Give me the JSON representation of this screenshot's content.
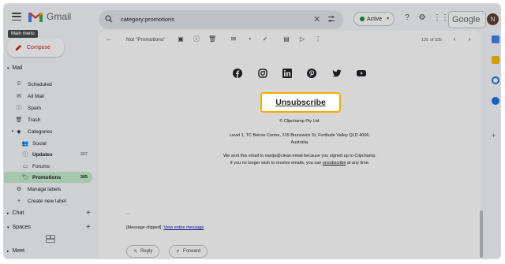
{
  "header": {
    "app_name": "Gmail",
    "search_value": "category:promotions",
    "status_label": "Active",
    "google_label": "Google",
    "avatar_initial": "N",
    "menu_tooltip": "Main menu"
  },
  "compose": {
    "label": "Compose"
  },
  "sidebar": {
    "mail_section": "Mail",
    "items": [
      {
        "icon": "scheduled-icon",
        "label": "Scheduled"
      },
      {
        "icon": "all-mail-icon",
        "label": "All Mail"
      },
      {
        "icon": "spam-icon",
        "label": "Spam"
      },
      {
        "icon": "trash-icon",
        "label": "Trash"
      },
      {
        "icon": "label-icon",
        "label": "Categories"
      },
      {
        "icon": "social-icon",
        "label": "Social"
      },
      {
        "icon": "updates-icon",
        "label": "Updates",
        "count": "387"
      },
      {
        "icon": "forums-icon",
        "label": "Forums"
      },
      {
        "icon": "promotions-icon",
        "label": "Promotions",
        "count": "305"
      },
      {
        "icon": "gear-icon",
        "label": "Manage labels"
      },
      {
        "icon": "plus-icon",
        "label": "Create new label"
      }
    ],
    "chat_section": "Chat",
    "spaces_section": "Spaces",
    "meet_section": "Meet"
  },
  "toolbar": {
    "label": "Not \"Promotions\"",
    "pager": "126 of 335"
  },
  "email": {
    "unsubscribe": "Unsubscribe",
    "copyright": "© Clipchamp Pty Ltd.",
    "address_line1": "Level 1, TC Beirne Centre, 315 Brunswick St, Fortitude Valley QLD 4006,",
    "address_line2": "Australia.",
    "sent_line": "We sent this email to nastja@clean.email because you signed up to Clipchamp.",
    "optout_prefix": "If you no longer wish to receive emails, you can",
    "optout_link": "unsubscribe",
    "optout_suffix": "at any time.",
    "ellipsis": "...",
    "clipped_text": "[Message clipped]",
    "clipped_link": "View entire message"
  },
  "actions": {
    "reply": "Reply",
    "forward": "Forward"
  },
  "colors": {
    "accent": "#f9ab00",
    "promotions_bg": "#c4eed0",
    "compose_red": "#c5221f"
  }
}
